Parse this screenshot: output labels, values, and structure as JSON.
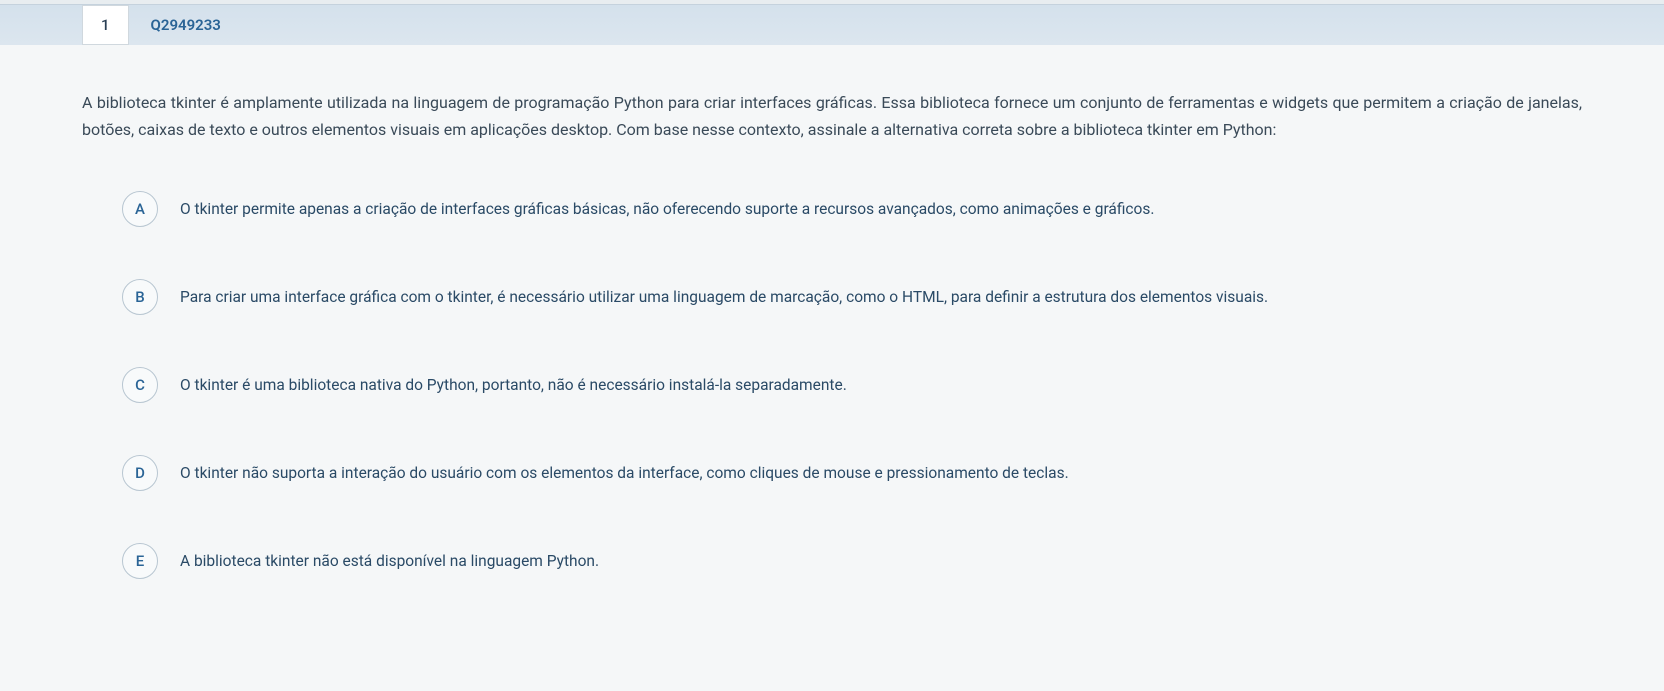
{
  "question": {
    "number": "1",
    "id": "Q2949233",
    "text": "A biblioteca tkinter é amplamente utilizada na linguagem de programação Python para criar interfaces gráficas. Essa biblioteca fornece um conjunto de ferramentas e widgets que permitem a criação de janelas, botões, caixas de texto e outros elementos visuais em aplicações desktop. Com base nesse contexto, assinale a alternativa correta sobre a biblioteca tkinter em Python:",
    "options": [
      {
        "letter": "A",
        "text": "O tkinter permite apenas a criação de interfaces gráficas básicas, não oferecendo suporte a recursos avançados, como animações e gráficos."
      },
      {
        "letter": "B",
        "text": "Para criar uma interface gráfica com o tkinter, é necessário utilizar uma linguagem de marcação, como o HTML, para definir a estrutura dos elementos visuais."
      },
      {
        "letter": "C",
        "text": "O tkinter é uma biblioteca nativa do Python, portanto, não é necessário instalá-la separadamente."
      },
      {
        "letter": "D",
        "text": "O tkinter não suporta a interação do usuário com os elementos da interface, como cliques de mouse e pressionamento de teclas."
      },
      {
        "letter": "E",
        "text": "A biblioteca tkinter não está disponível na linguagem Python."
      }
    ]
  }
}
